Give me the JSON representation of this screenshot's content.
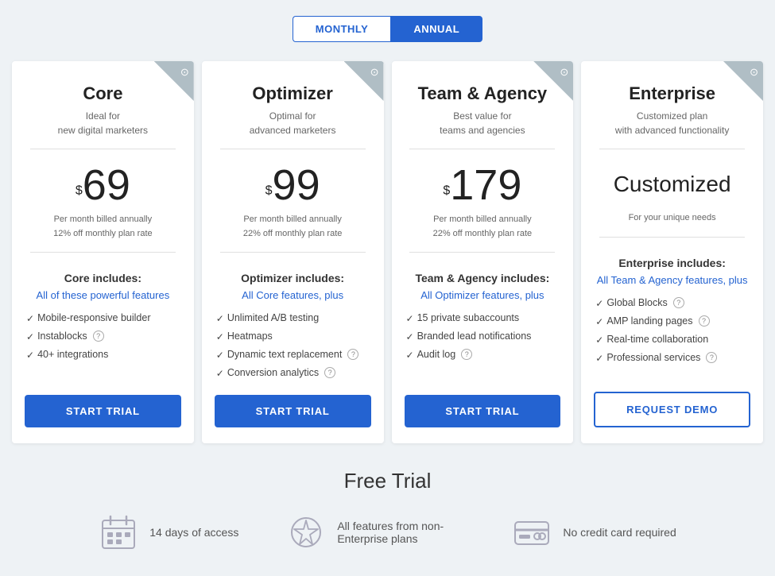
{
  "billing": {
    "monthly_label": "MONTHLY",
    "annual_label": "ANNUAL",
    "active": "annual"
  },
  "plans": [
    {
      "id": "core",
      "name": "Core",
      "subtitle_line1": "Ideal for",
      "subtitle_line2": "new digital marketers",
      "price_symbol": "$",
      "price": "69",
      "price_note_line1": "Per month billed annually",
      "price_note_line2": "12% off monthly plan rate",
      "includes_title": "Core includes:",
      "includes_link": "All of these powerful features",
      "features": [
        {
          "text": "Mobile-responsive builder",
          "info": false
        },
        {
          "text": "Instablocks",
          "info": true
        },
        {
          "text": "40+ integrations",
          "info": false
        }
      ],
      "cta_label": "START TRIAL",
      "cta_type": "primary"
    },
    {
      "id": "optimizer",
      "name": "Optimizer",
      "subtitle_line1": "Optimal for",
      "subtitle_line2": "advanced marketers",
      "price_symbol": "$",
      "price": "99",
      "price_note_line1": "Per month billed annually",
      "price_note_line2": "22% off monthly plan rate",
      "includes_title": "Optimizer includes:",
      "includes_link": "All Core features, plus",
      "features": [
        {
          "text": "Unlimited A/B testing",
          "info": false
        },
        {
          "text": "Heatmaps",
          "info": false
        },
        {
          "text": "Dynamic text replacement",
          "info": true
        },
        {
          "text": "Conversion analytics",
          "info": true
        }
      ],
      "cta_label": "START TRIAL",
      "cta_type": "primary"
    },
    {
      "id": "team-agency",
      "name": "Team & Agency",
      "subtitle_line1": "Best value for",
      "subtitle_line2": "teams and agencies",
      "price_symbol": "$",
      "price": "179",
      "price_note_line1": "Per month billed annually",
      "price_note_line2": "22% off monthly plan rate",
      "includes_title": "Team & Agency includes:",
      "includes_link": "All Optimizer features, plus",
      "features": [
        {
          "text": "15 private subaccounts",
          "info": false
        },
        {
          "text": "Branded lead notifications",
          "info": false
        },
        {
          "text": "Audit log",
          "info": true
        }
      ],
      "cta_label": "START TRIAL",
      "cta_type": "primary"
    },
    {
      "id": "enterprise",
      "name": "Enterprise",
      "subtitle_line1": "Customized plan",
      "subtitle_line2": "with advanced functionality",
      "price_customized": "Customized",
      "price_for_unique": "For your unique needs",
      "includes_title": "Enterprise includes:",
      "includes_link": "All Team & Agency features, plus",
      "features": [
        {
          "text": "Global Blocks",
          "info": true
        },
        {
          "text": "AMP landing pages",
          "info": true
        },
        {
          "text": "Real-time collaboration",
          "info": false
        },
        {
          "text": "Professional services",
          "info": true
        }
      ],
      "cta_label": "REQUEST DEMO",
      "cta_type": "outline"
    }
  ],
  "free_trial": {
    "title": "Free Trial",
    "items": [
      {
        "icon": "calendar-icon",
        "text": "14 days of access"
      },
      {
        "icon": "star-icon",
        "text": "All features from non-Enterprise plans"
      },
      {
        "icon": "card-icon",
        "text": "No credit card required"
      }
    ]
  }
}
